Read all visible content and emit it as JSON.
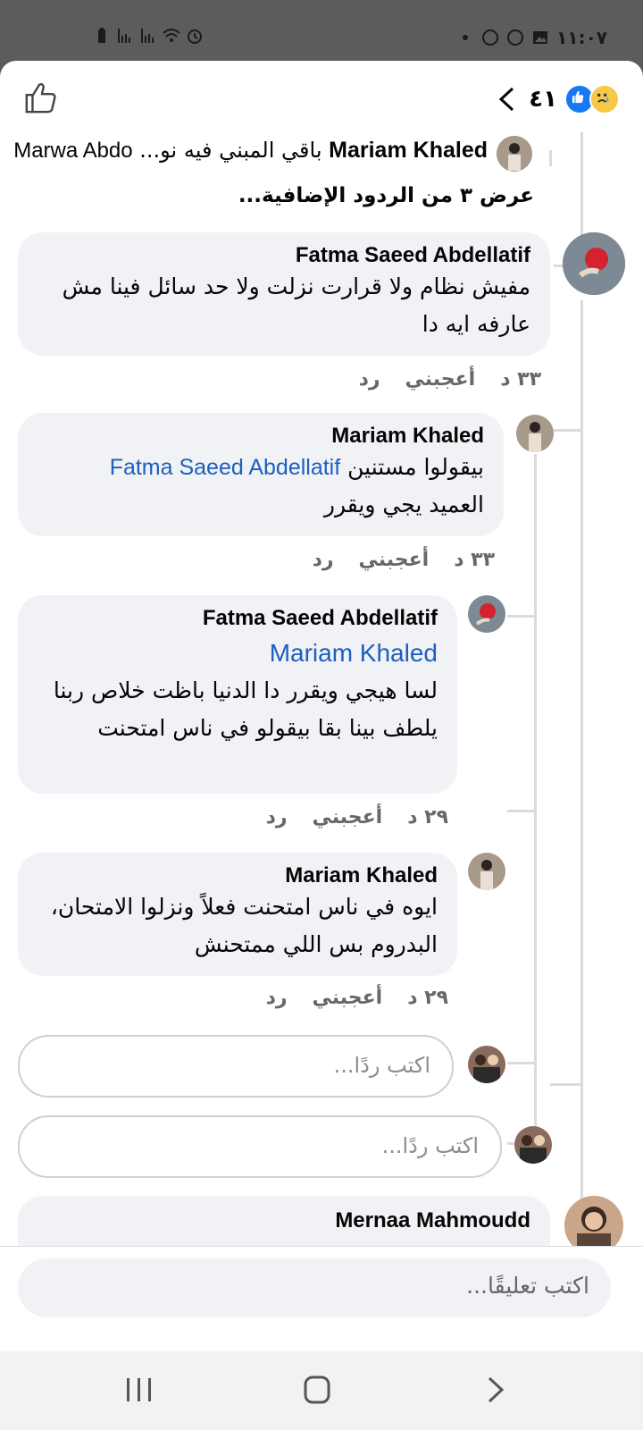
{
  "status_bar": {
    "time": "١١:٠٧",
    "left_icons": [
      "battery-icon",
      "signal-icon",
      "signal-icon",
      "wifi-icon",
      "alarm-icon"
    ],
    "right_icons": [
      "dot-icon",
      "whatsapp-icon",
      "whatsapp-icon",
      "gallery-icon"
    ]
  },
  "header": {
    "reaction_count": "٤١",
    "reactions": [
      "like",
      "sad"
    ]
  },
  "collapsed_reply": {
    "author": "Mariam Khaled",
    "snippet": "باقي المبني فيه نو...",
    "mention": "Marwa Abdo"
  },
  "view_more_replies": "عرض ٣ من الردود الإضافية...",
  "comments": [
    {
      "author": "Fatma Saeed Abdellatif",
      "text": "مفيش نظام ولا قرارت نزلت ولا حد سائل فينا مش عارفه ايه دا",
      "time": "٣٣ د",
      "like_label": "أعجبني",
      "reply_label": "رد"
    },
    {
      "author": "Mariam Khaled",
      "mention": "Fatma Saeed Abdellatif",
      "text": "بيقولوا مستنين",
      "text2": "العميد يجي ويقرر",
      "time": "٣٣ د",
      "like_label": "أعجبني",
      "reply_label": "رد"
    },
    {
      "author": "Fatma Saeed Abdellatif",
      "mention": "Mariam Khaled",
      "text": "لسا هيجي ويقرر دا الدنيا باظت خلاص ربنا يلطف بينا بقا بيقولو في ناس امتحنت",
      "time": "٢٩ د",
      "like_label": "أعجبني",
      "reply_label": "رد"
    },
    {
      "author": "Mariam Khaled",
      "text": "ايوه في ناس امتحنت فعلاً ونزلوا الامتحان، البدروم بس اللي ممتحنش",
      "time": "٢٩ د",
      "like_label": "أعجبني",
      "reply_label": "رد"
    }
  ],
  "reply_placeholder": "اكتب ردًا...",
  "reply_placeholder_2": "اكتب ردًا...",
  "next_comment_author": "Mernaa Mahmoudd",
  "comment_placeholder": "اكتب تعليقًا...",
  "colors": {
    "accent": "#1877f2",
    "mention": "#1c5fbf",
    "bubble": "#f0f2f5"
  }
}
